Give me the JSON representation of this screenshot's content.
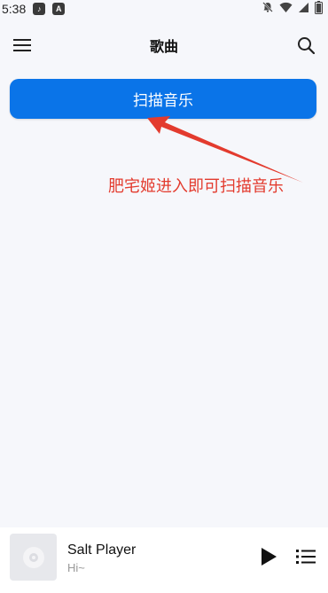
{
  "status_bar": {
    "time": "5:38",
    "badge_letter": "A",
    "icons": [
      "music-note-icon",
      "a-badge-icon",
      "notifications-off-icon",
      "wifi-icon",
      "signal-icon",
      "battery-icon"
    ]
  },
  "header": {
    "title": "歌曲",
    "menu_icon": "hamburger-menu-icon",
    "search_icon": "search-icon"
  },
  "main": {
    "scan_button_label": "扫描音乐",
    "annotation_text": "肥宅姬进入即可扫描音乐"
  },
  "player": {
    "title": "Salt Player",
    "subtitle": "Hi~",
    "play_icon": "play-icon",
    "queue_icon": "playlist-icon"
  },
  "colors": {
    "accent": "#0a74e8",
    "annotation": "#e33b2e",
    "background": "#f6f7fb"
  }
}
